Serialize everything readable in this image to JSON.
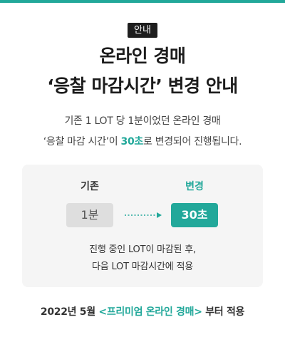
{
  "colors": {
    "accent": "#22a89a",
    "top_bar": "#22a89a",
    "badge_bg": "#1e1e1e",
    "panel_bg": "#f5f5f5"
  },
  "badge": "안내",
  "title": {
    "line1": "온라인 경매",
    "line2": "‘응찰 마감시간’ 변경 안내"
  },
  "description": {
    "line1": "기존 1 LOT 당 1분이었던 온라인 경매",
    "line2_before": "‘응찰 마감 시간’이 ",
    "line2_highlight": "30초",
    "line2_after": "로 변경되어 진행됩니다."
  },
  "comparison": {
    "before_label": "기존",
    "before_value": "1분",
    "after_label": "변경",
    "after_value": "30초",
    "arrow_icon": "dotted-arrow-right-icon",
    "note_line1": "진행 중인 LOT이 마감된 후,",
    "note_line2": "다음 LOT 마감시간에 적용"
  },
  "footer": {
    "date": "2022년 5월 ",
    "highlight": "<프리미엄 온라인 경매>",
    "suffix": " 부터 적용"
  }
}
